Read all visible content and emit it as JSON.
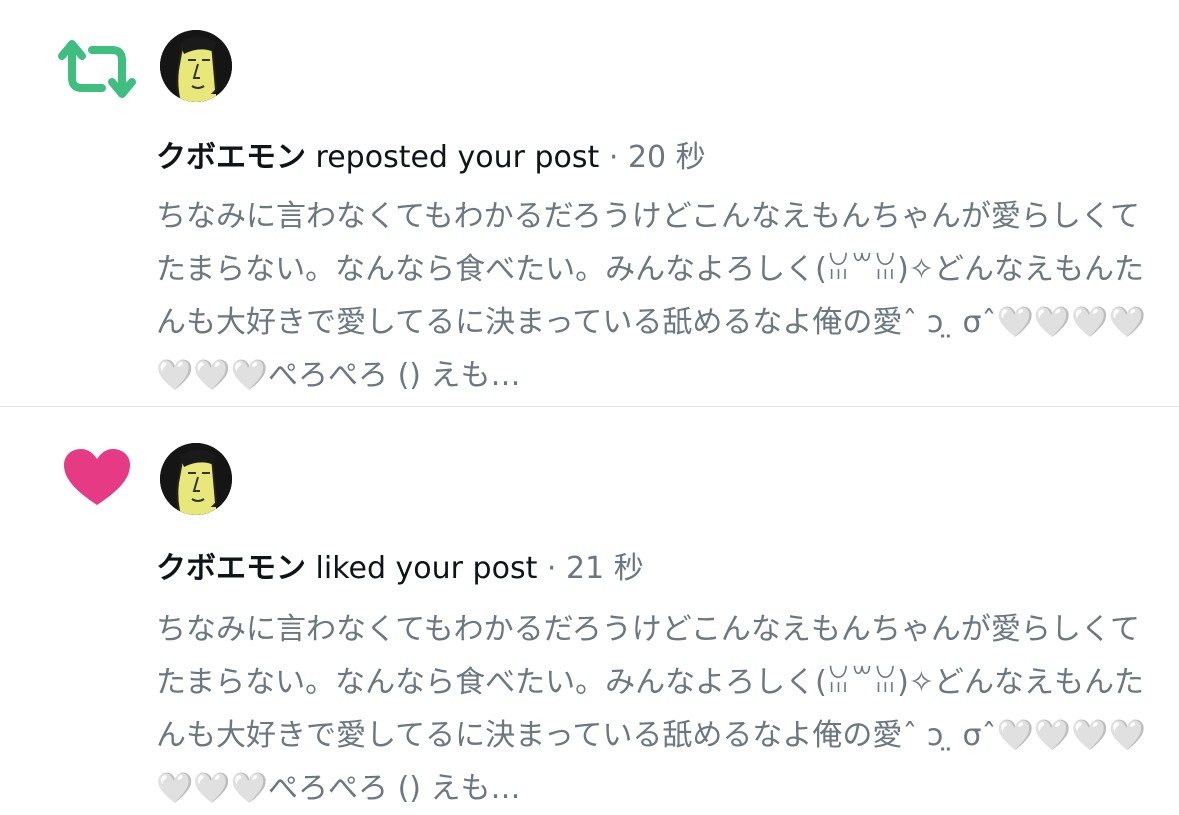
{
  "notifications": [
    {
      "type": "repost",
      "icon": "repost-icon",
      "icon_color": "#3fbf7f",
      "user_name": "クボエモン",
      "action": "reposted your post",
      "separator": "·",
      "time": "20 秒",
      "post_text": "ちなみに言わなくてもわかるだろうけどこんなえもんちゃんが愛らしくてたまらない。なんなら食べたい。みんなよろしく(ꈍ꒳ꈍ)✧どんなえもんたんも大好きで愛してるに決まっている舐めるなよ俺の愛ˆ ᴐ ̤ σˆ🤍🤍🤍🤍🤍🤍🤍ぺろぺろ () えも…"
    },
    {
      "type": "like",
      "icon": "heart-icon",
      "icon_color": "#e73a85",
      "user_name": "クボエモン",
      "action": "liked your post",
      "separator": "·",
      "time": "21 秒",
      "post_text": "ちなみに言わなくてもわかるだろうけどこんなえもんちゃんが愛らしくてたまらない。なんなら食べたい。みんなよろしく(ꈍ꒳ꈍ)✧どんなえもんたんも大好きで愛してるに決まっている舐めるなよ俺の愛ˆ ᴐ ̤ σˆ🤍🤍🤍🤍🤍🤍🤍ぺろぺろ () えも…"
    }
  ]
}
